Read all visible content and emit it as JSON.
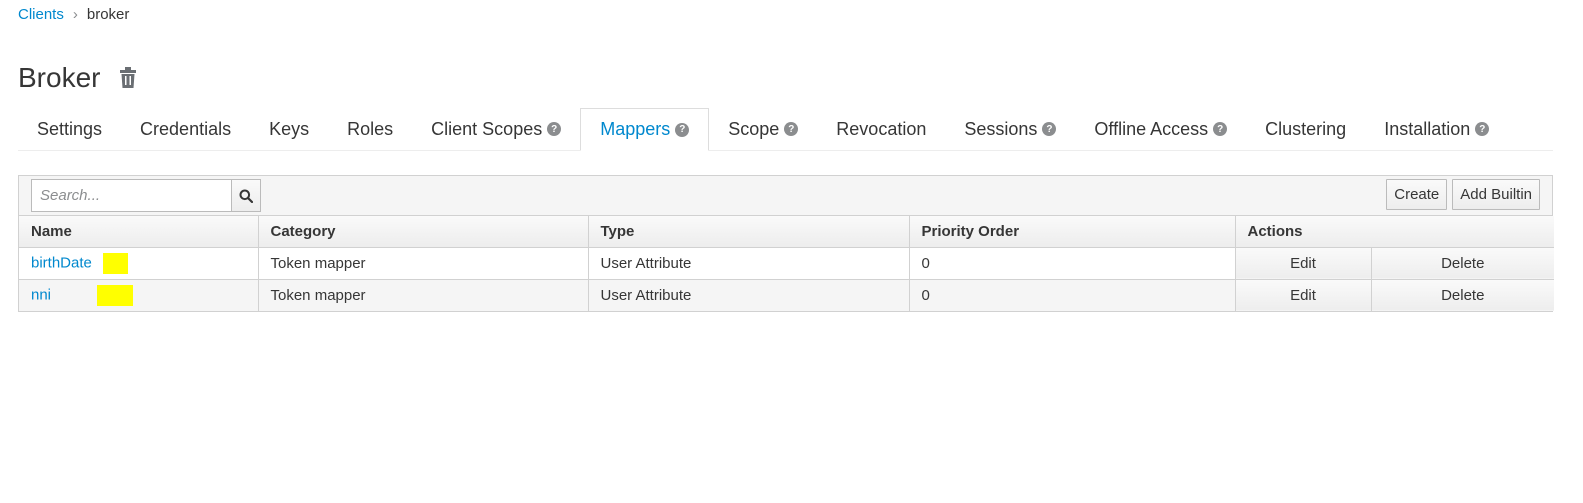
{
  "breadcrumb": {
    "parent": "Clients",
    "current": "broker"
  },
  "page": {
    "title": "Broker"
  },
  "tabs": [
    {
      "label": "Settings",
      "help": false
    },
    {
      "label": "Credentials",
      "help": false
    },
    {
      "label": "Keys",
      "help": false
    },
    {
      "label": "Roles",
      "help": false
    },
    {
      "label": "Client Scopes",
      "help": true
    },
    {
      "label": "Mappers",
      "help": true,
      "active": true
    },
    {
      "label": "Scope",
      "help": true
    },
    {
      "label": "Revocation",
      "help": false
    },
    {
      "label": "Sessions",
      "help": true
    },
    {
      "label": "Offline Access",
      "help": true
    },
    {
      "label": "Clustering",
      "help": false
    },
    {
      "label": "Installation",
      "help": true
    }
  ],
  "toolbar": {
    "search_placeholder": "Search...",
    "create_label": "Create",
    "add_builtin_label": "Add Builtin"
  },
  "table": {
    "headers": [
      "Name",
      "Category",
      "Type",
      "Priority Order",
      "Actions"
    ],
    "rows": [
      {
        "name": "birthDate",
        "category": "Token mapper",
        "type": "User Attribute",
        "priority": "0",
        "edit": "Edit",
        "delete": "Delete"
      },
      {
        "name": "nni",
        "category": "Token mapper",
        "type": "User Attribute",
        "priority": "0",
        "edit": "Edit",
        "delete": "Delete"
      }
    ]
  },
  "colors": {
    "link": "#0088ce",
    "highlight": "#ffff00"
  }
}
